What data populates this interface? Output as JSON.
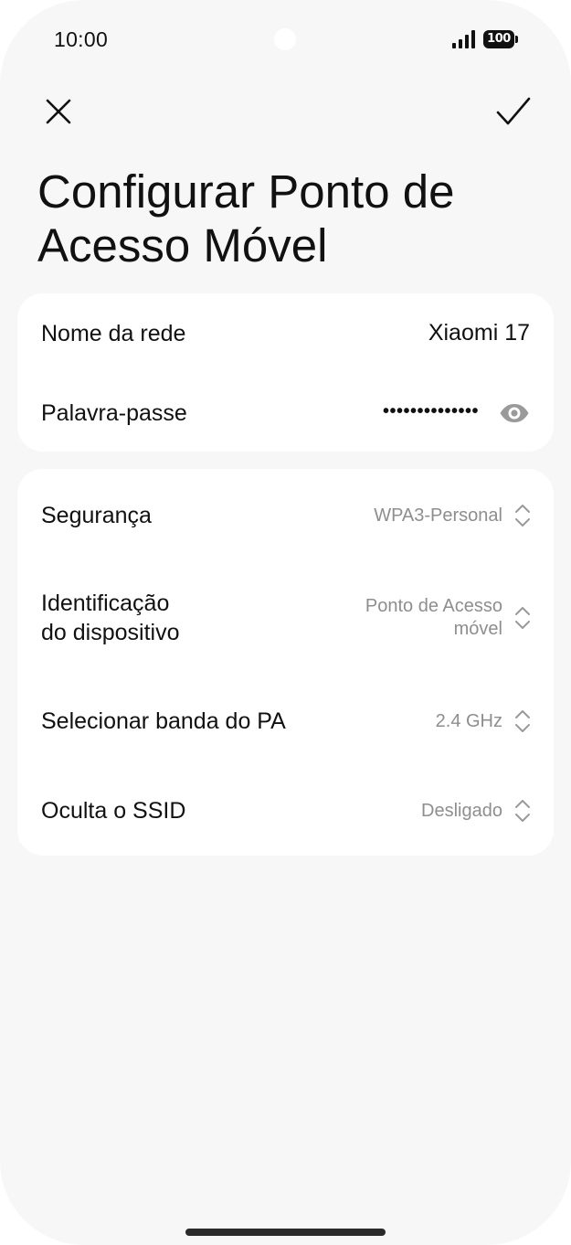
{
  "status_bar": {
    "time": "10:00",
    "battery": "100"
  },
  "toolbar": {
    "close_icon": "close-icon",
    "confirm_icon": "check-icon"
  },
  "page": {
    "title": "Configurar Ponto de Acesso Móvel"
  },
  "network_card": {
    "name_label": "Nome da rede",
    "name_value": "Xiaomi 17",
    "password_label": "Palavra-passe",
    "password_value": "••••••••••••••",
    "password_toggle_icon": "eye-icon"
  },
  "settings_card": {
    "security_label": "Segurança",
    "security_value": "WPA3-Personal",
    "device_id_label_line1": "Identificação",
    "device_id_label_line2": "do dispositivo",
    "device_id_value_line1": "Ponto de Acesso",
    "device_id_value_line2": "móvel",
    "band_label": "Selecionar banda do PA",
    "band_value": "2.4 GHz",
    "hide_ssid_label": "Oculta o SSID",
    "hide_ssid_value": "Desligado"
  },
  "colors": {
    "background": "#f7f7f7",
    "card": "#ffffff",
    "text_primary": "#111111",
    "text_secondary": "#8e8e8e",
    "icon_muted": "#9a9a9a"
  }
}
